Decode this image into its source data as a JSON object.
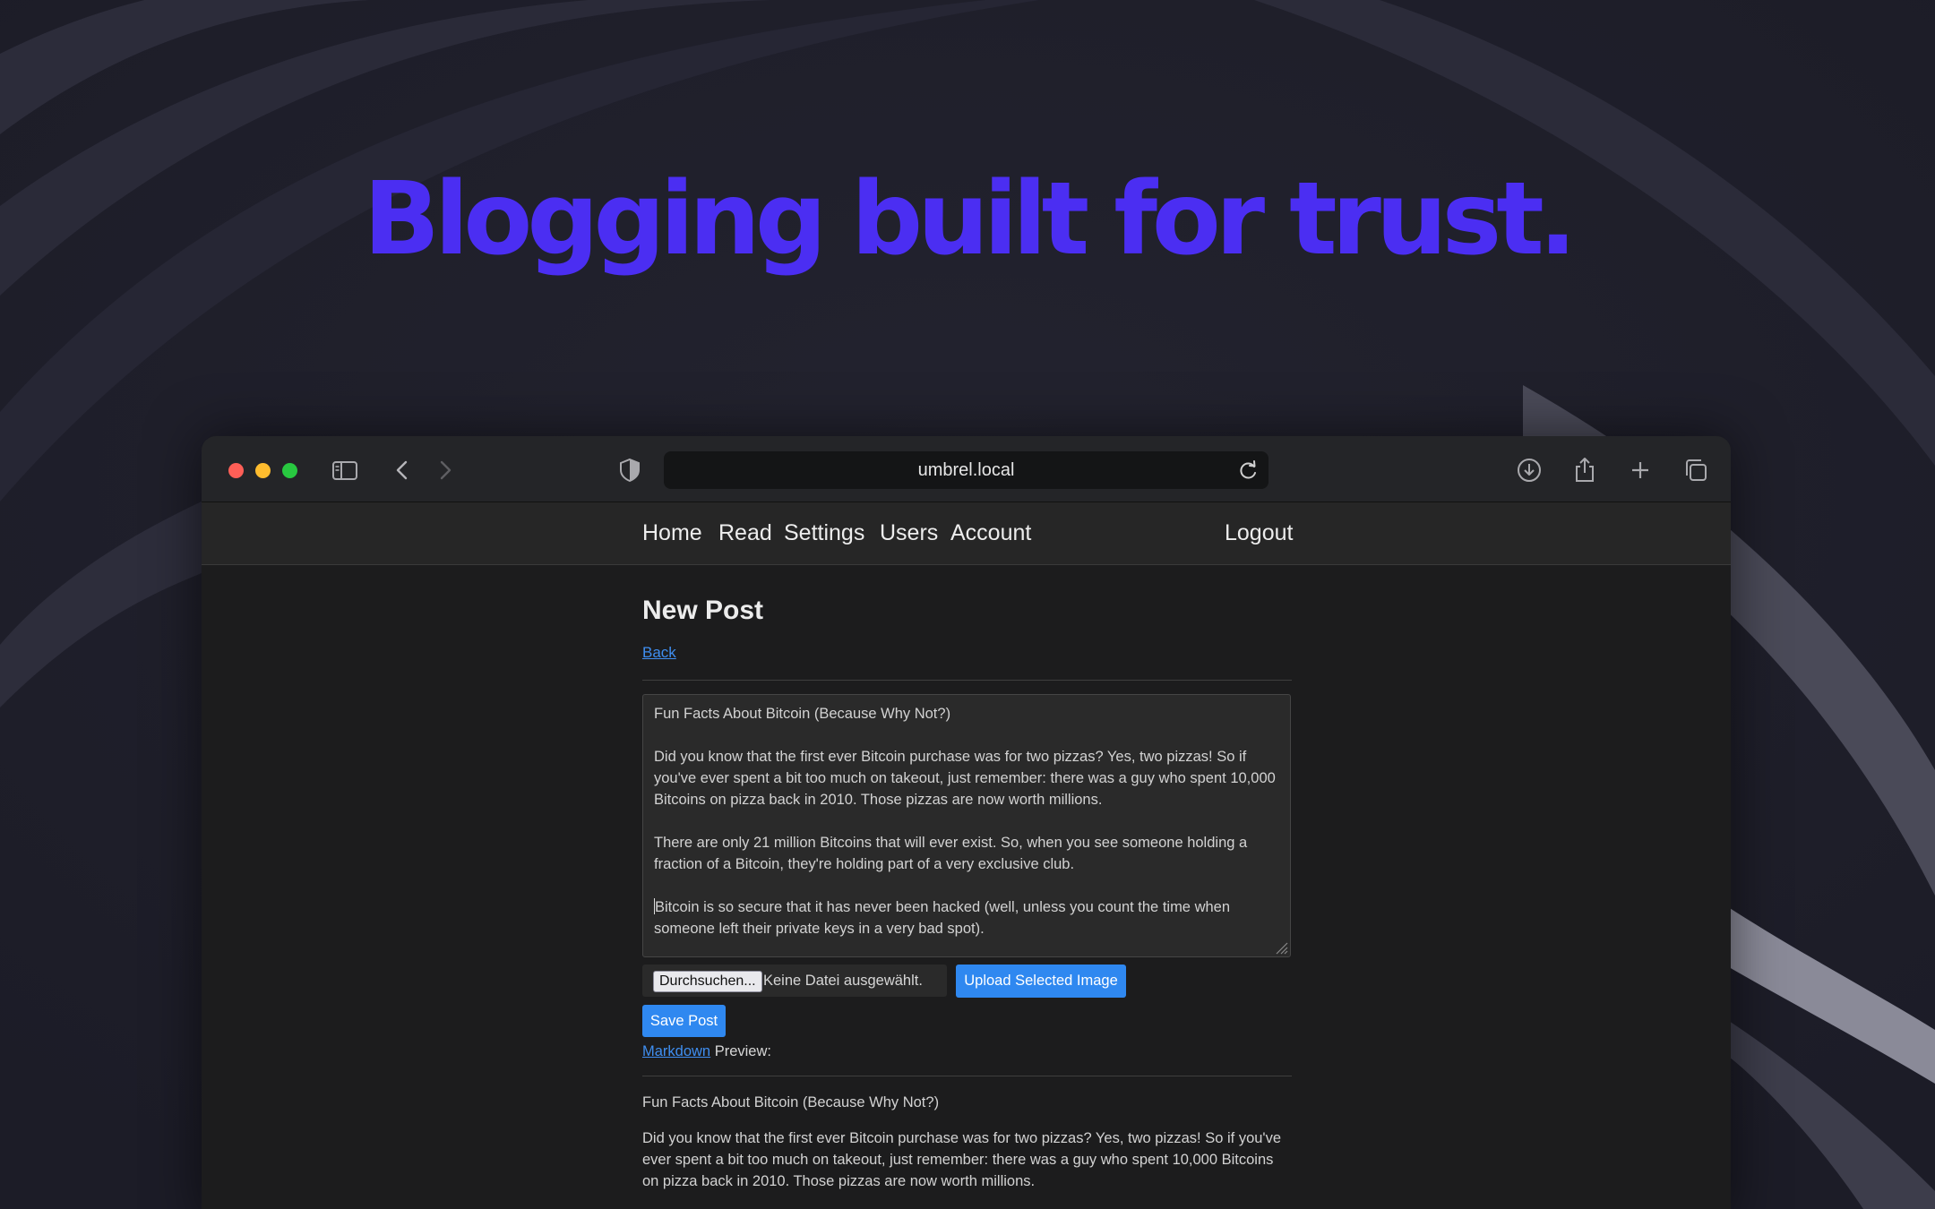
{
  "hero": {
    "headline": "Blogging built for trust."
  },
  "browser": {
    "url": "umbrel.local",
    "icons": [
      "sidebar-icon",
      "back-arrow-icon",
      "forward-arrow-icon",
      "shield-icon",
      "reload-icon",
      "download-icon",
      "share-icon",
      "new-tab-icon",
      "tab-overview-icon"
    ]
  },
  "nav": {
    "home": "Home",
    "read": "Read",
    "settings": "Settings",
    "users": "Users",
    "account": "Account",
    "logout": "Logout"
  },
  "page": {
    "title": "New Post",
    "back": "Back"
  },
  "editor": {
    "line1": "Fun Facts About Bitcoin (Because Why Not?)",
    "para1": "Did you know that the first ever Bitcoin purchase was for two pizzas? Yes, two pizzas! So if you've ever spent a bit too much on takeout, just remember: there was a guy who spent 10,000 Bitcoins on pizza back in 2010. Those pizzas are now worth millions.",
    "para2": "There are only 21 million Bitcoins that will ever exist. So, when you see someone holding a fraction of a Bitcoin, they're holding part of a very exclusive club.",
    "para3": "Bitcoin is so secure that it has never been hacked (well, unless you count the time when someone left their private keys in a very bad spot)."
  },
  "upload": {
    "browse_label": "Durchsuchen...",
    "no_file": "Keine Datei ausgewählt.",
    "upload_label": "Upload Selected Image"
  },
  "save_label": "Save Post",
  "preview": {
    "markdown_link": "Markdown",
    "label_suffix": " Preview:",
    "title_line": "Fun Facts About Bitcoin (Because Why Not?)",
    "para1": "Did you know that the first ever Bitcoin purchase was for two pizzas? Yes, two pizzas! So if you've ever spent a bit too much on takeout, just remember: there was a guy who spent 10,000 Bitcoins on pizza back in 2010. Those pizzas are now worth millions."
  },
  "colors": {
    "accent": "#4b2ef2",
    "link": "#3f8ef0",
    "button": "#2f88f0",
    "background": "#1c1c1d"
  }
}
